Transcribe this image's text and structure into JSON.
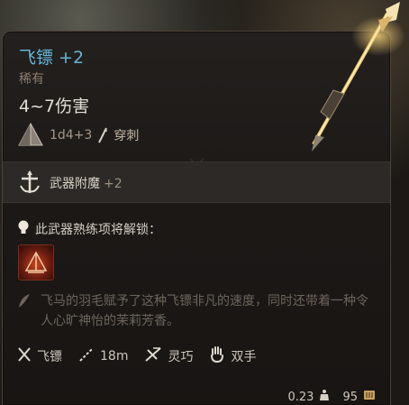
{
  "item": {
    "name": "飞镖 +2",
    "rarity": "稀有",
    "damage": "4~7伤害",
    "dice": "1d4+3",
    "damage_type": "穿刺"
  },
  "enchant": {
    "label": "武器附魔",
    "bonus": "+2"
  },
  "proficiency": {
    "unlock_text": "此武器熟练项将解锁："
  },
  "flavor": {
    "text": "飞马的羽毛赋予了这种飞镖非凡的速度，同时还带着一种令人心旷神怡的茉莉芳香。"
  },
  "properties": [
    {
      "icon": "dart-icon",
      "label": "飞镖"
    },
    {
      "icon": "range-icon",
      "label": "18m"
    },
    {
      "icon": "finesse-icon",
      "label": "灵巧"
    },
    {
      "icon": "hand-icon",
      "label": "双手"
    }
  ],
  "footer": {
    "weight": "0.23",
    "value": "95"
  },
  "colors": {
    "title": "#64b6d8",
    "rarity": "#8c7e6e",
    "border": "#4c4339"
  }
}
